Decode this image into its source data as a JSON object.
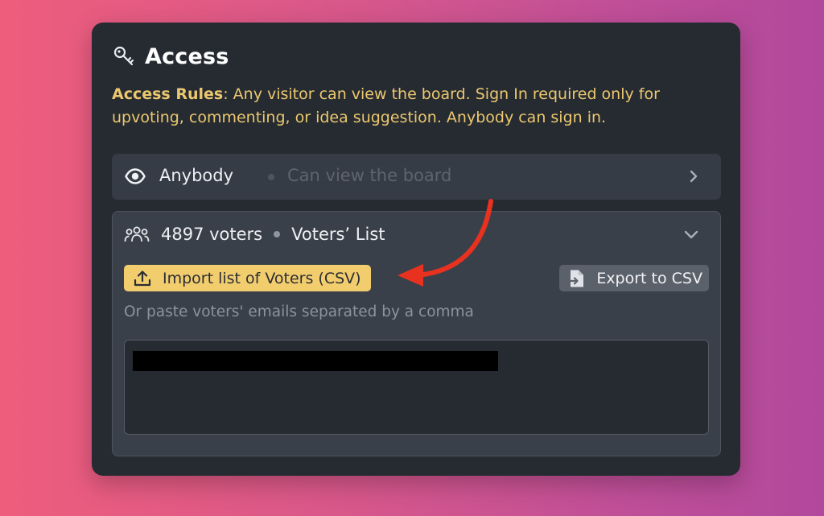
{
  "access": {
    "title": "Access",
    "title_icon": "key-icon",
    "rules_label": "Access Rules",
    "rules_text": ": Any visitor can view the board. Sign In required only for upvoting, commenting, or idea suggestion. Anybody can sign in."
  },
  "anybody_row": {
    "icon": "eye-icon",
    "label": "Anybody",
    "description": "Can view the board"
  },
  "voters": {
    "icon": "people-icon",
    "count_label": "4897 voters",
    "list_label": "Voters’ List",
    "import_button": "Import list of Voters (CSV)",
    "export_button": "Export to CSV",
    "paste_hint": "Or paste voters' emails separated by a comma"
  },
  "colors": {
    "accent": "#f2cd6e",
    "panel_bg": "#262b32",
    "annotation_arrow": "#e8321f"
  }
}
